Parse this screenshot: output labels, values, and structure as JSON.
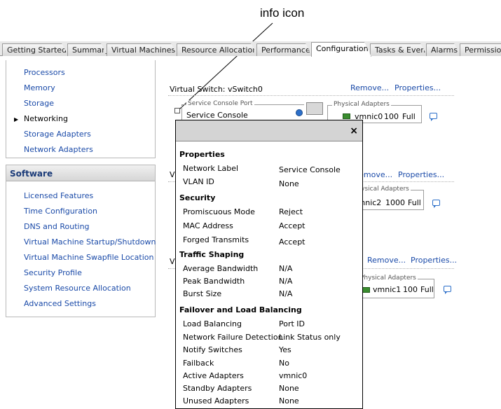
{
  "callout": {
    "label": "info icon"
  },
  "tabs": [
    "Getting Started",
    "Summary",
    "Virtual Machines",
    "Resource Allocation",
    "Performance",
    "Configuration",
    "Tasks & Events",
    "Alarms",
    "Permissions"
  ],
  "hardware_items": [
    "Processors",
    "Memory",
    "Storage",
    "Networking",
    "Storage Adapters",
    "Network Adapters"
  ],
  "software": {
    "header": "Software",
    "items": [
      "Licensed Features",
      "Time Configuration",
      "DNS and Routing",
      "Virtual Machine Startup/Shutdown",
      "Virtual Machine Swapfile Location",
      "Security Profile",
      "System Resource Allocation",
      "Advanced Settings"
    ]
  },
  "vswitch0": {
    "title": "Virtual Switch: vSwitch0",
    "remove": "Remove...",
    "properties": "Properties...",
    "port_legend": "Service Console Port",
    "port_name": "Service Console",
    "adapters_legend": "Physical Adapters",
    "nic": "vmnic0",
    "speed": "100",
    "duplex": "Full"
  },
  "vswitch1": {
    "remove": "Remove...",
    "properties": "Properties...",
    "adapters_legend": "Physical Adapters",
    "nic": "vmnic2",
    "speed": "1000",
    "duplex": "Full"
  },
  "vswitch2": {
    "remove": "Remove...",
    "properties": "Properties...",
    "adapters_legend": "Physical Adapters",
    "nic": "vmnic1",
    "speed": "100",
    "duplex": "Full"
  },
  "popup": {
    "close": "×",
    "properties": {
      "heading": "Properties",
      "rows": [
        [
          "Network Label",
          "Service Console"
        ],
        [
          "VLAN ID",
          "None"
        ]
      ]
    },
    "security": {
      "heading": "Security",
      "rows": [
        [
          "Promiscuous Mode",
          "Reject"
        ],
        [
          "MAC Address",
          "Accept"
        ],
        [
          "Forged Transmits",
          "Accept"
        ]
      ]
    },
    "traffic": {
      "heading": "Traffic Shaping",
      "rows": [
        [
          "Average Bandwidth",
          "N/A"
        ],
        [
          "Peak Bandwidth",
          "N/A"
        ],
        [
          "Burst Size",
          "N/A"
        ]
      ]
    },
    "failover": {
      "heading": "Failover and Load Balancing",
      "rows": [
        [
          "Load Balancing",
          "Port ID"
        ],
        [
          "Network Failure Detection",
          "Link Status only"
        ],
        [
          "Notify Switches",
          "Yes"
        ],
        [
          "Failback",
          "No"
        ],
        [
          "Active Adapters",
          "vmnic0"
        ],
        [
          "Standby Adapters",
          "None"
        ],
        [
          "Unused Adapters",
          "None"
        ]
      ]
    }
  }
}
